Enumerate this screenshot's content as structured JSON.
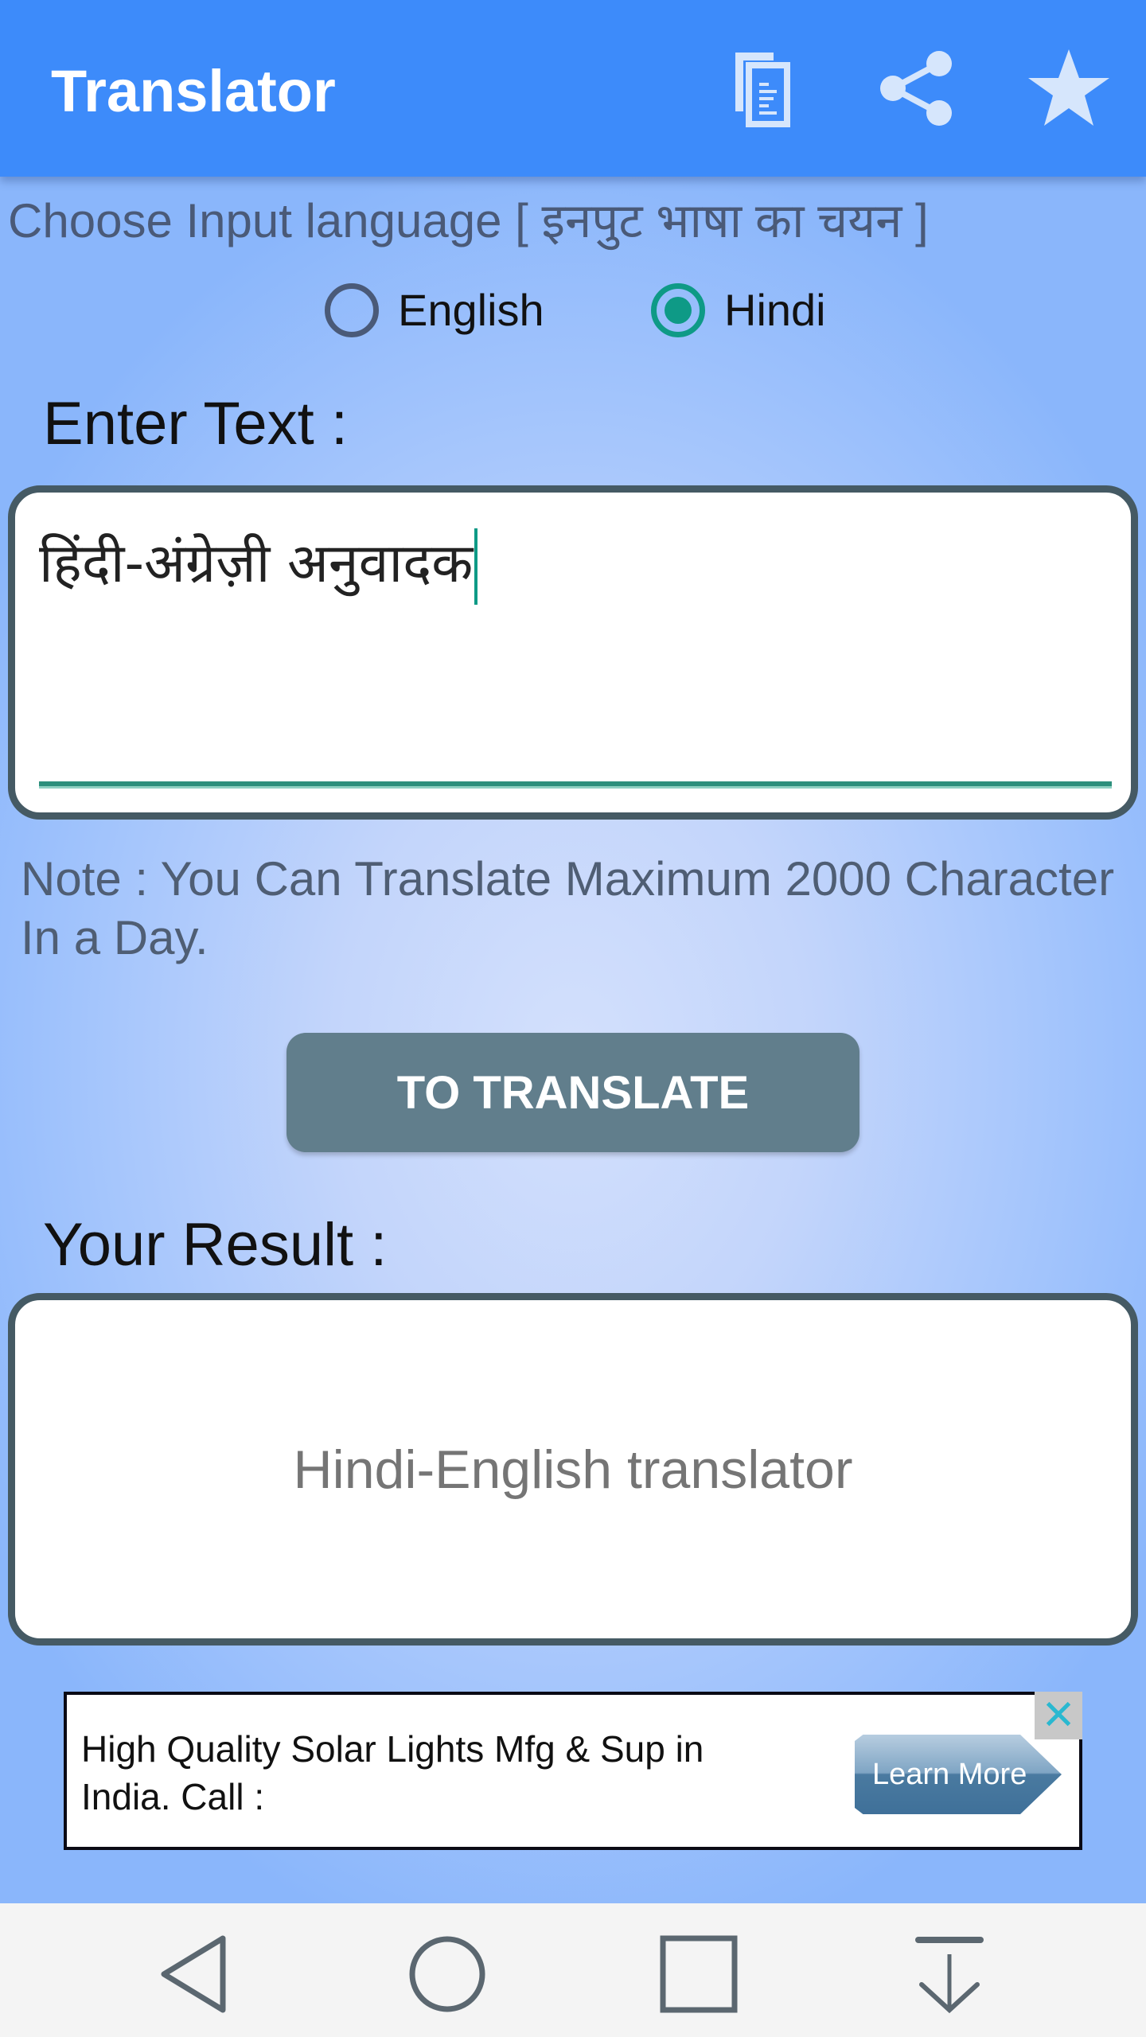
{
  "app_bar": {
    "title": "Translator",
    "actions": [
      {
        "name": "copy-icon",
        "label": "Copy"
      },
      {
        "name": "share-icon",
        "label": "Share"
      },
      {
        "name": "star-icon",
        "label": "Rate"
      }
    ]
  },
  "language_chooser": {
    "label": "Choose Input language [ इनपुट भाषा का चयन  ]",
    "options": [
      {
        "label": "English",
        "checked": false
      },
      {
        "label": "Hindi",
        "checked": true
      }
    ]
  },
  "input": {
    "label": "Enter Text :",
    "value": "हिंदी-अंग्रेज़ी अनुवादक"
  },
  "note": "Note  :  You Can Translate Maximum 2000 Character In a Day.",
  "translate_button": "TO TRANSLATE",
  "result": {
    "label": "Your Result :",
    "value": "Hindi-English translator"
  },
  "ad": {
    "text": "High Quality Solar Lights Mfg & Sup in India. Call :",
    "cta": "Learn More",
    "close": "✕"
  },
  "nav_bar": {
    "buttons": [
      "back",
      "home",
      "recents",
      "hide-keyboard"
    ]
  },
  "colors": {
    "app_bar": "#3d8bfa",
    "accent": "#0e9a86",
    "button": "#617e8c",
    "box_border": "#455a64"
  }
}
